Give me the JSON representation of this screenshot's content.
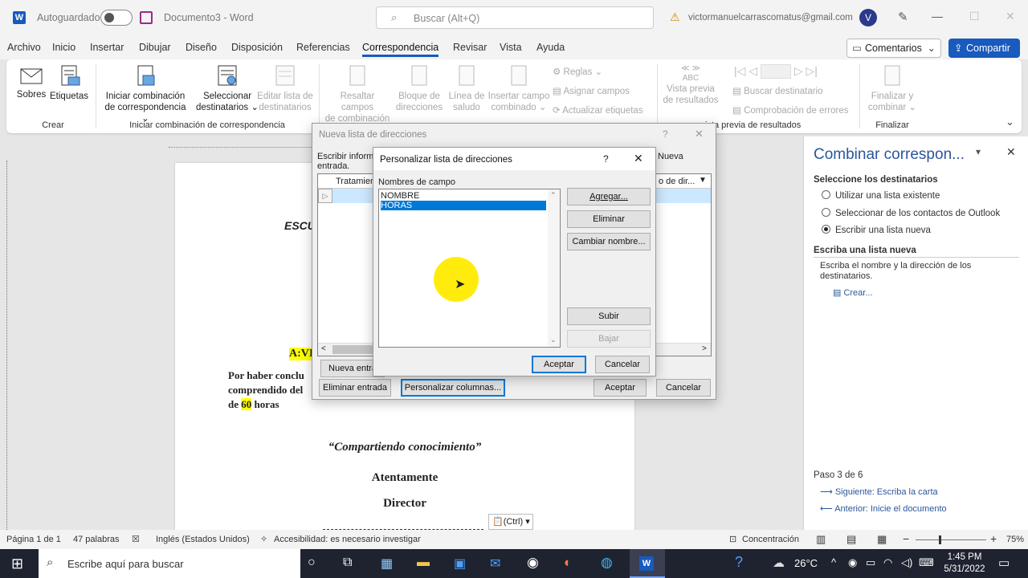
{
  "titlebar": {
    "autosave_label": "Autoguardado",
    "doc_title": "Documento3  -  Word",
    "search_placeholder": "Buscar (Alt+Q)",
    "account": "victormanuelcarrascomatus@gmail.com",
    "avatar_letter": "V"
  },
  "tabs": [
    "Archivo",
    "Inicio",
    "Insertar",
    "Dibujar",
    "Diseño",
    "Disposición",
    "Referencias",
    "Correspondencia",
    "Revisar",
    "Vista",
    "Ayuda"
  ],
  "comments_label": "Comentarios",
  "share_label": "Compartir",
  "ribbon": {
    "sobres": "Sobres",
    "etiquetas": "Etiquetas",
    "iniciar_1": "Iniciar combinación",
    "iniciar_2": "de correspondencia",
    "seleccionar_1": "Seleccionar",
    "seleccionar_2": "destinatarios",
    "editar_1": "Editar lista de",
    "editar_2": "destinatarios",
    "resaltar_1": "Resaltar campos",
    "resaltar_2": "de combinación",
    "bloque_1": "Bloque de",
    "bloque_2": "direcciones",
    "linea_1": "Línea de",
    "linea_2": "saludo",
    "insertar_1": "Insertar campo",
    "insertar_2": "combinado",
    "reglas": "Reglas",
    "asignar": "Asignar campos",
    "actualizar": "Actualizar etiquetas",
    "vista_1": "Vista previa",
    "vista_2": "de resultados",
    "buscar_dest": "Buscar destinatario",
    "comprobacion": "Comprobación de errores",
    "finalizar_1": "Finalizar y",
    "finalizar_2": "combinar",
    "grp_crear": "Crear",
    "grp_iniciar": "Iniciar combinación de correspondencia",
    "grp_vista": "ista previa de resultados",
    "grp_finalizar": "Finalizar"
  },
  "document": {
    "escu": "ESCU",
    "a_vi": "A:VI",
    "line1": "Por haber conclu",
    "line2": "comprendido del",
    "line3_pre": "de ",
    "line3_num": "60",
    "line3_post": " horas",
    "quote": "“Compartiendo conocimiento”",
    "atentamente": "Atentamente",
    "director": "Director",
    "ctrl_label": "(Ctrl)"
  },
  "dialog_outer": {
    "title": "Nueva lista de direcciones",
    "help": "?",
    "intro_1": "Escribir inform",
    "intro_2": "entrada.",
    "nueva_right": "Nueva",
    "col_tratamiento": "Tratamient",
    "col_dir": "o de dir...",
    "btn_nueva": "Nueva entra",
    "btn_eliminar": "Eliminar entrada",
    "btn_personalizar": "Personalizar columnas...",
    "btn_aceptar": "Aceptar",
    "btn_cancelar": "Cancelar"
  },
  "dialog_inner": {
    "title": "Personalizar lista de direcciones",
    "help": "?",
    "field_label": "Nombres de campo",
    "fields": [
      "NOMBRE",
      "HORAS"
    ],
    "selected_index": 1,
    "btn_agregar": "Agregar...",
    "btn_eliminar": "Eliminar",
    "btn_cambiar": "Cambiar nombre...",
    "btn_subir": "Subir",
    "btn_bajar": "Bajar",
    "btn_aceptar": "Aceptar",
    "btn_cancelar": "Cancelar"
  },
  "pane": {
    "title": "Combinar correspon...",
    "section1": "Seleccione los destinatarios",
    "options": [
      "Utilizar una lista existente",
      "Seleccionar de los contactos de Outlook",
      "Escribir una lista nueva"
    ],
    "selected_option": 2,
    "section2": "Escriba una lista nueva",
    "desc": "Escriba el nombre y la dirección de los destinatarios.",
    "crear": "Crear...",
    "step": "Paso 3 de 6",
    "next": "Siguiente: Escriba la carta",
    "prev": "Anterior: Inicie el documento"
  },
  "status": {
    "page": "Página 1 de 1",
    "words": "47 palabras",
    "lang": "Inglés (Estados Unidos)",
    "access": "Accesibilidad: es necesario investigar",
    "focus": "Concentración",
    "zoom": "75%"
  },
  "taskbar": {
    "search": "Escribe aquí para buscar",
    "temp": "26°C",
    "time": "1:45 PM",
    "date": "5/31/2022"
  },
  "colors": {
    "accent": "#185abd",
    "highlight": "#ffff00",
    "selection": "#0078d7"
  }
}
